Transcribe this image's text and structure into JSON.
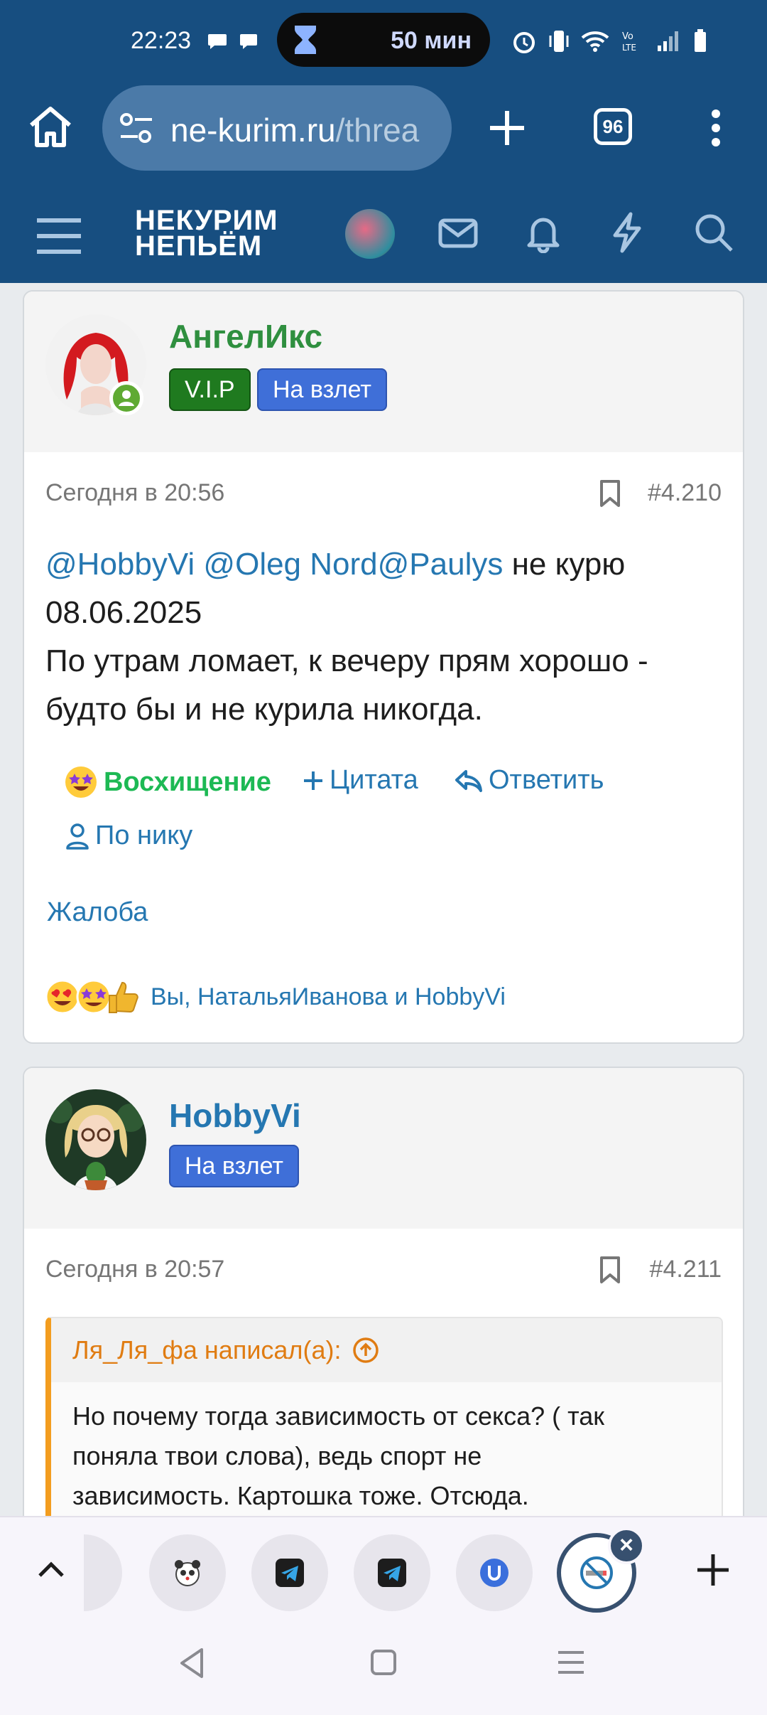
{
  "status_bar": {
    "time": "22:23",
    "timer_pill": "50 мин"
  },
  "browser": {
    "url_domain": "ne-kurim.ru",
    "url_rest": "/threa",
    "tab_count": "96"
  },
  "site": {
    "logo_line1": "НЕКУРИМ",
    "logo_line2": "НЕПЬЁМ"
  },
  "posts": [
    {
      "author": "АнгелИкс",
      "author_color": "#2f8f3f",
      "badges": [
        "V.I.P",
        "На взлет"
      ],
      "time": "Сегодня в 20:56",
      "number": "#4.210",
      "mentions": [
        "@HobbyVi",
        "@Oleg Nord",
        "@Paulys"
      ],
      "text_after_mentions": " не курю",
      "lines": [
        "08.06.2025",
        "По утрам ломает, к вечеру прям хорошо -",
        "будто бы и не курила никогда."
      ],
      "actions": {
        "reaction": "Восхищение",
        "quote": "Цитата",
        "reply": "Ответить",
        "by_nick": "По нику",
        "report": "Жалоба"
      },
      "reactions_summary": "Вы, НатальяИванова и HobbyVi"
    },
    {
      "author": "HobbyVi",
      "author_color": "#2577b1",
      "badges": [
        "На взлет"
      ],
      "time": "Сегодня в 20:57",
      "number": "#4.211",
      "quote": {
        "header": "Ля_Ля_фа написал(а):",
        "lines": [
          "Но почему тогда зависимость от секса? ( так",
          "поняла твои слова), ведь спорт не",
          "зависимость. Картошка тоже. Отсюда."
        ]
      }
    }
  ],
  "colors": {
    "brand": "#174e80",
    "link": "#2577b1",
    "vip_badge": "#1f7a1f",
    "rank_badge": "#3f6fd8",
    "reaction_label": "#1db954",
    "quote_accent": "#f39d1f"
  }
}
